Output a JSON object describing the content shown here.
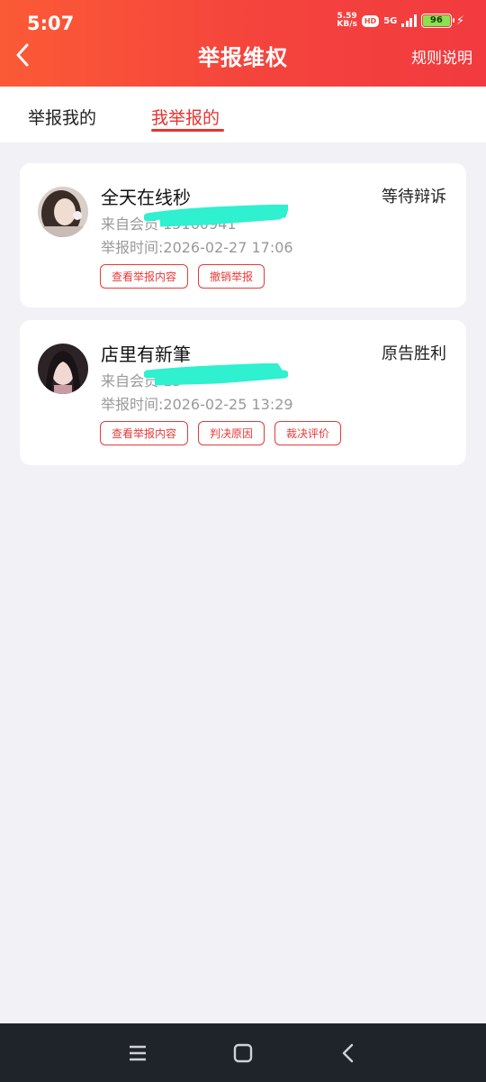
{
  "status_bar": {
    "time": "5:07",
    "net_speed_value": "5.59",
    "net_speed_unit": "KB/s",
    "hd_badge": "HD",
    "network": "5G",
    "battery": "96"
  },
  "header": {
    "title": "举报维权",
    "rules_label": "规则说明"
  },
  "tabs": [
    {
      "label": "举报我的",
      "active": false
    },
    {
      "label": "我举报的",
      "active": true
    }
  ],
  "reports": [
    {
      "name": "全天在线秒",
      "status": "等待辩诉",
      "from": "来自会员 15160941",
      "time": "举报时间:2026-02-27 17:06",
      "actions": [
        "查看举报内容",
        "撤销举报"
      ]
    },
    {
      "name": "店里有新筆",
      "status": "原告胜利",
      "from": "来自会员 13",
      "time": "举报时间:2026-02-25 13:29",
      "actions": [
        "查看举报内容",
        "判决原因",
        "裁决评价"
      ]
    }
  ],
  "colors": {
    "header_gradient_start": "#fb5a36",
    "header_gradient_end": "#f23a3f",
    "accent_red": "#e63a38",
    "page_background": "#f2f2f6",
    "redaction_mark": "#2ff0cf",
    "system_nav_background": "#1f232a"
  },
  "icons": {
    "back": "chevron-left-icon",
    "system_menu": "menu-icon",
    "system_home": "home-square-icon",
    "system_back": "back-chevron-icon"
  }
}
